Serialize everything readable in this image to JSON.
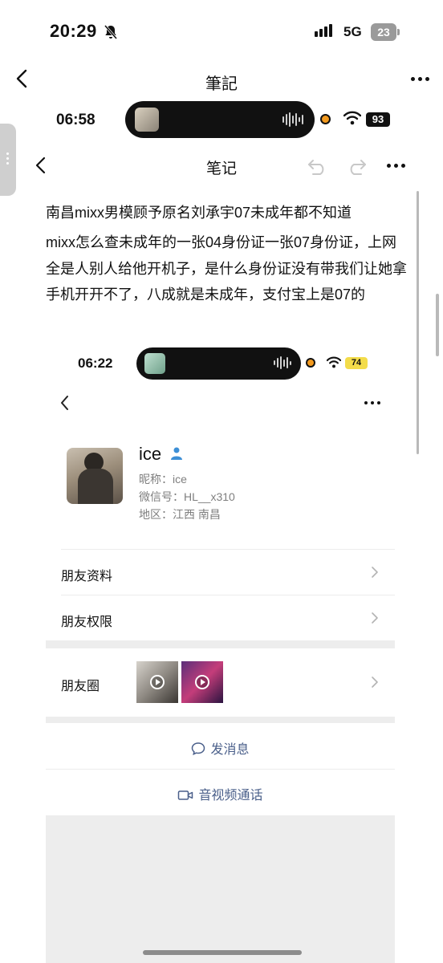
{
  "status_bar": {
    "time": "20:29",
    "network": "5G",
    "battery": "23"
  },
  "nav": {
    "title": "筆記"
  },
  "inner_status": {
    "time": "06:58",
    "battery": "93"
  },
  "notes_nav": {
    "title": "笔记"
  },
  "note": {
    "line1": "南昌mixx男模顾予原名刘承宇07未成年都不知道",
    "line2": "mixx怎么查未成年的一张04身份证一张07身份证，上网全是人别人给他开机子，是什么身份证没有带我们让她拿手机开开不了，八成就是未成年，支付宝上是07的"
  },
  "embedded": {
    "status_time": "06:22",
    "battery": "74",
    "profile": {
      "name": "ice",
      "nickname": "昵称：ice",
      "wechat_id": "微信号：HL__x310",
      "region": "地区：江西 南昌"
    },
    "rows": {
      "friend_info": "朋友资料",
      "friend_permissions": "朋友权限",
      "moments": "朋友圈"
    },
    "actions": {
      "send_message": "发消息",
      "video_call": "音视频通话"
    }
  },
  "colors": {
    "accent_link": "#4a5f8a",
    "orange_dot": "#f39a1e",
    "battery_yellow": "#f3dc4a"
  }
}
